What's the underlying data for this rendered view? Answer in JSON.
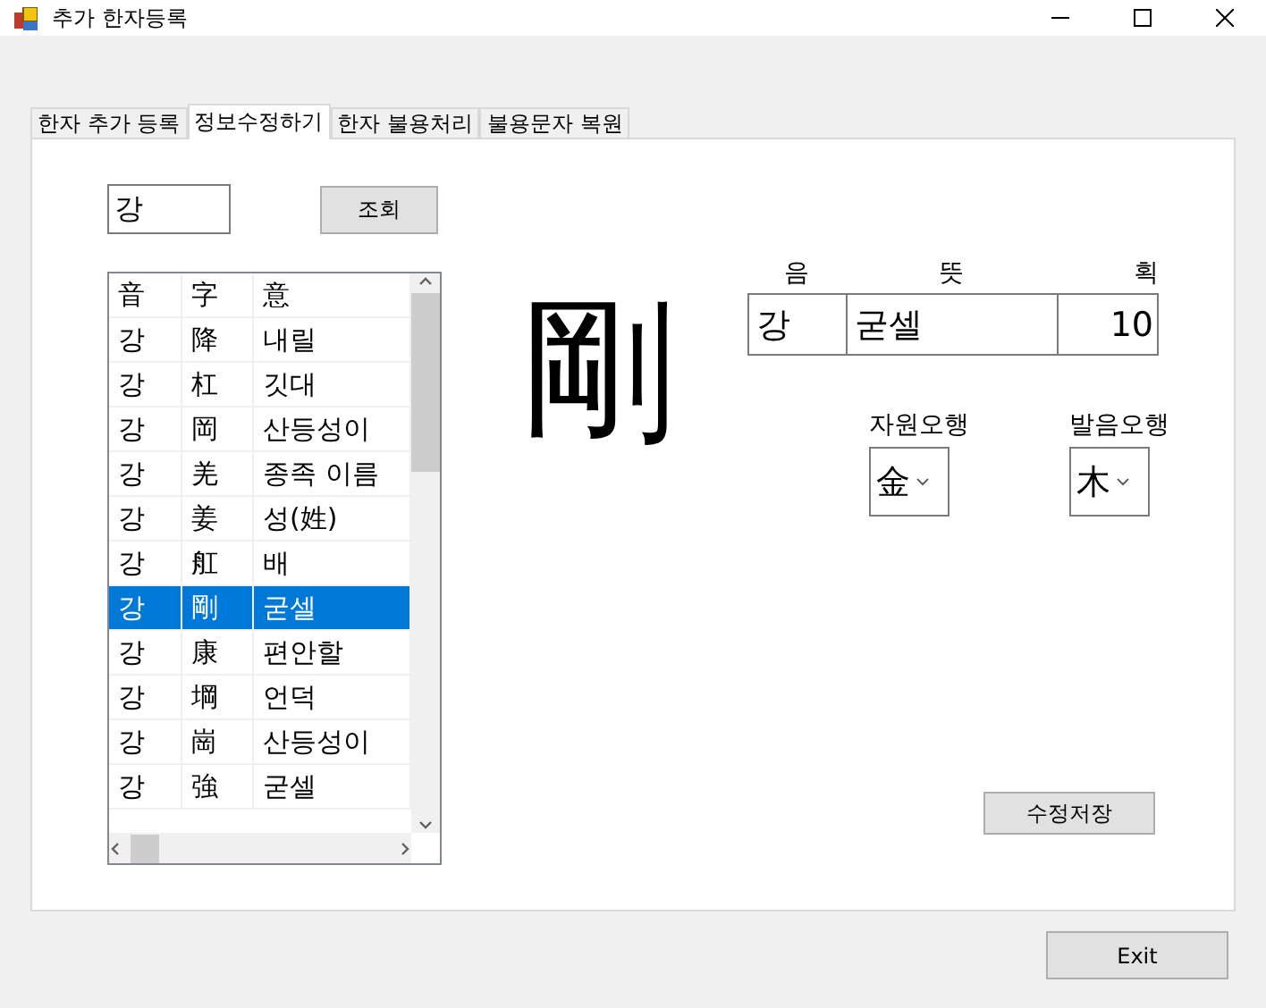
{
  "window": {
    "title": "추가 한자등록"
  },
  "tabs": [
    {
      "label": "한자 추가 등록",
      "selected": false
    },
    {
      "label": "정보수정하기",
      "selected": true
    },
    {
      "label": "한자 불용처리",
      "selected": false
    },
    {
      "label": "불용문자 복원",
      "selected": false
    }
  ],
  "search": {
    "value": "강",
    "button": "조회"
  },
  "list": {
    "columns": [
      "音",
      "字",
      "意"
    ],
    "rows": [
      {
        "cells": [
          "강",
          "降",
          "내릴"
        ],
        "selected": false
      },
      {
        "cells": [
          "강",
          "杠",
          "깃대"
        ],
        "selected": false
      },
      {
        "cells": [
          "강",
          "岡",
          "산등성이"
        ],
        "selected": false
      },
      {
        "cells": [
          "강",
          "羌",
          "종족 이름"
        ],
        "selected": false
      },
      {
        "cells": [
          "강",
          "姜",
          "성(姓)"
        ],
        "selected": false
      },
      {
        "cells": [
          "강",
          "舡",
          "배"
        ],
        "selected": false
      },
      {
        "cells": [
          "강",
          "剛",
          "굳셀"
        ],
        "selected": true
      },
      {
        "cells": [
          "강",
          "康",
          "편안할"
        ],
        "selected": false
      },
      {
        "cells": [
          "강",
          "堈",
          "언덕"
        ],
        "selected": false
      },
      {
        "cells": [
          "강",
          "崗",
          "산등성이"
        ],
        "selected": false
      },
      {
        "cells": [
          "강",
          "強",
          "굳셀"
        ],
        "selected": false
      }
    ]
  },
  "preview": {
    "character": "剛"
  },
  "detail": {
    "labels": [
      "음",
      "뜻",
      "획"
    ],
    "values": [
      "강",
      "굳셀",
      "10"
    ]
  },
  "elements": [
    {
      "label": "자원오행",
      "value": "金"
    },
    {
      "label": "발음오행",
      "value": "木"
    }
  ],
  "save_button": "수정저장",
  "exit_button": "Exit"
}
